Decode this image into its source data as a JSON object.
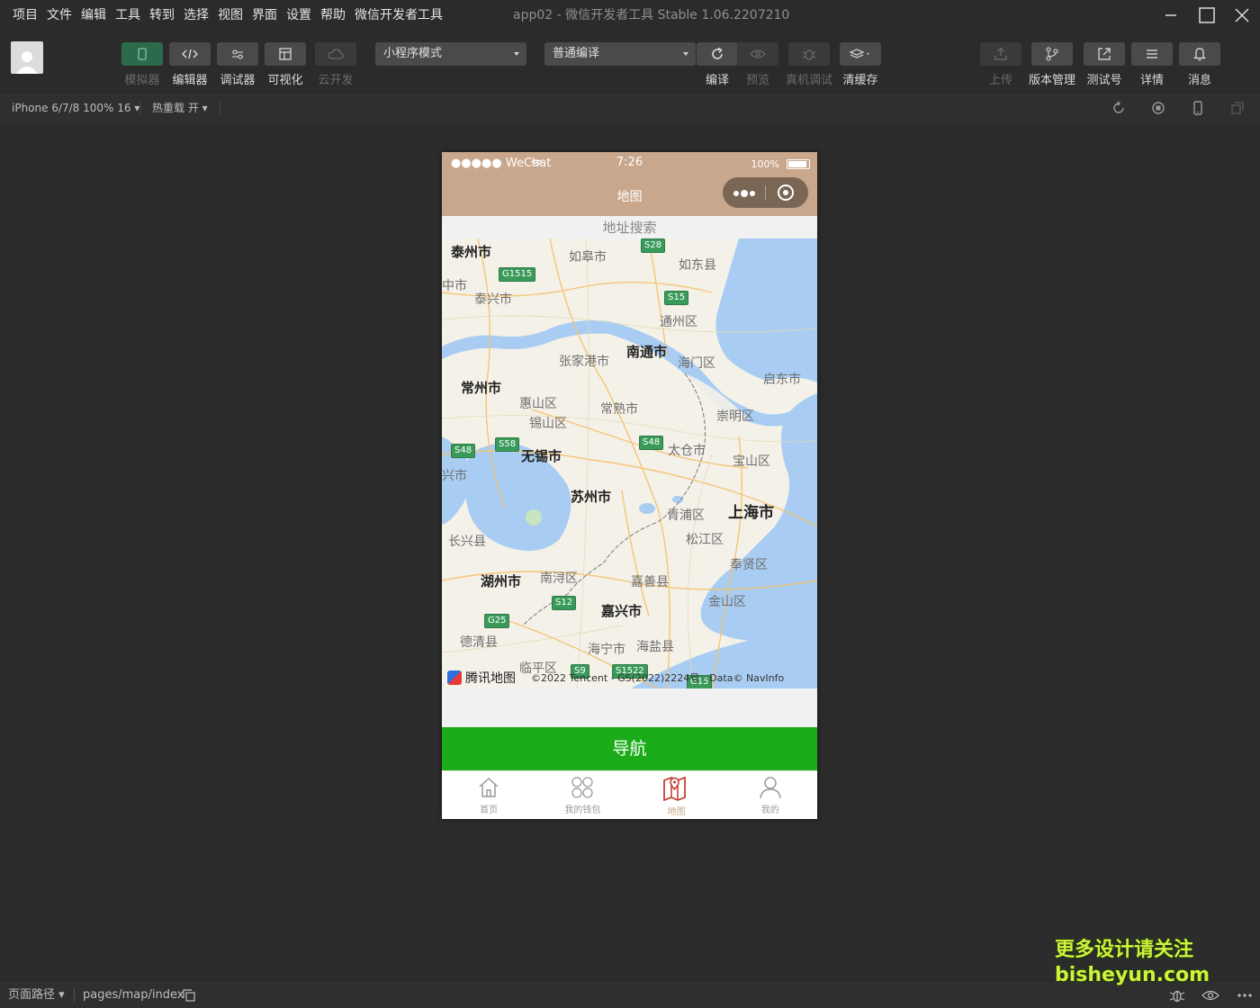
{
  "menubar": {
    "menus": [
      "项目",
      "文件",
      "编辑",
      "工具",
      "转到",
      "选择",
      "视图",
      "界面",
      "设置",
      "帮助",
      "微信开发者工具"
    ],
    "window_title": "app02 - 微信开发者工具 Stable 1.06.2207210"
  },
  "toolbar": {
    "simulator": "模拟器",
    "editor": "编辑器",
    "debugger": "调试器",
    "visual": "可视化",
    "cloud": "云开发",
    "mode_select": "小程序模式",
    "compile_select": "普通编译",
    "compile": "编译",
    "preview": "预览",
    "remote_debug": "真机调试",
    "clear_cache": "清缓存",
    "upload": "上传",
    "version": "版本管理",
    "test_account": "测试号",
    "details": "详情",
    "messages": "消息"
  },
  "subbar": {
    "device": "iPhone 6/7/8 100% 16 ▾",
    "hot_reload": "热重载 开 ▾"
  },
  "phone": {
    "status": {
      "signal": "●●●●● WeChat",
      "time": "7:26",
      "battery": "100%"
    },
    "nav_title": "地图",
    "search_label": "地址搜索",
    "map": {
      "cities": [
        {
          "name": "泰州市",
          "major": true
        },
        {
          "name": "如皋市"
        },
        {
          "name": "如东县"
        },
        {
          "name": "中市"
        },
        {
          "name": "泰兴市"
        },
        {
          "name": "通州区"
        },
        {
          "name": "南通市",
          "major": true
        },
        {
          "name": "张家港市"
        },
        {
          "name": "海门区"
        },
        {
          "name": "启东市"
        },
        {
          "name": "常州市",
          "major": true
        },
        {
          "name": "惠山区"
        },
        {
          "name": "常熟市"
        },
        {
          "name": "锡山区"
        },
        {
          "name": "崇明区"
        },
        {
          "name": "太仓市"
        },
        {
          "name": "无锡市",
          "major": true
        },
        {
          "name": "宝山区"
        },
        {
          "name": "兴市"
        },
        {
          "name": "苏州市",
          "major": true
        },
        {
          "name": "青浦区"
        },
        {
          "name": "上海市",
          "major": true,
          "big": true
        },
        {
          "name": "长兴县"
        },
        {
          "name": "松江区"
        },
        {
          "name": "奉贤区"
        },
        {
          "name": "湖州市",
          "major": true
        },
        {
          "name": "南浔区"
        },
        {
          "name": "嘉善县"
        },
        {
          "name": "金山区"
        },
        {
          "name": "嘉兴市",
          "major": true
        },
        {
          "name": "德清县"
        },
        {
          "name": "海宁市"
        },
        {
          "name": "海盐县"
        },
        {
          "name": "临平区"
        }
      ],
      "shields": [
        "S28",
        "G1515",
        "S15",
        "S48",
        "S58",
        "S48",
        "S12",
        "G25",
        "S9",
        "S1522",
        "G15"
      ],
      "logo": "腾讯地图",
      "copyright": "©2022 Tencent - GS(2022)2224号 - Data© NavInfo"
    },
    "nav_button": "导航",
    "tabs": [
      {
        "label": "首页",
        "icon": "home-icon"
      },
      {
        "label": "我的钱包",
        "icon": "wallet-icon"
      },
      {
        "label": "地图",
        "icon": "map-icon",
        "active": true
      },
      {
        "label": "我的",
        "icon": "user-icon"
      }
    ]
  },
  "bottombar": {
    "path_label": "页面路径 ▾",
    "route": "pages/map/index"
  },
  "watermark": {
    "line1": "更多设计请关注",
    "line2": "bisheyun.com"
  },
  "colors": {
    "nav_bg": "#c8a78c",
    "button_green": "#1aad19",
    "ide_bg": "#2c2c2c"
  }
}
